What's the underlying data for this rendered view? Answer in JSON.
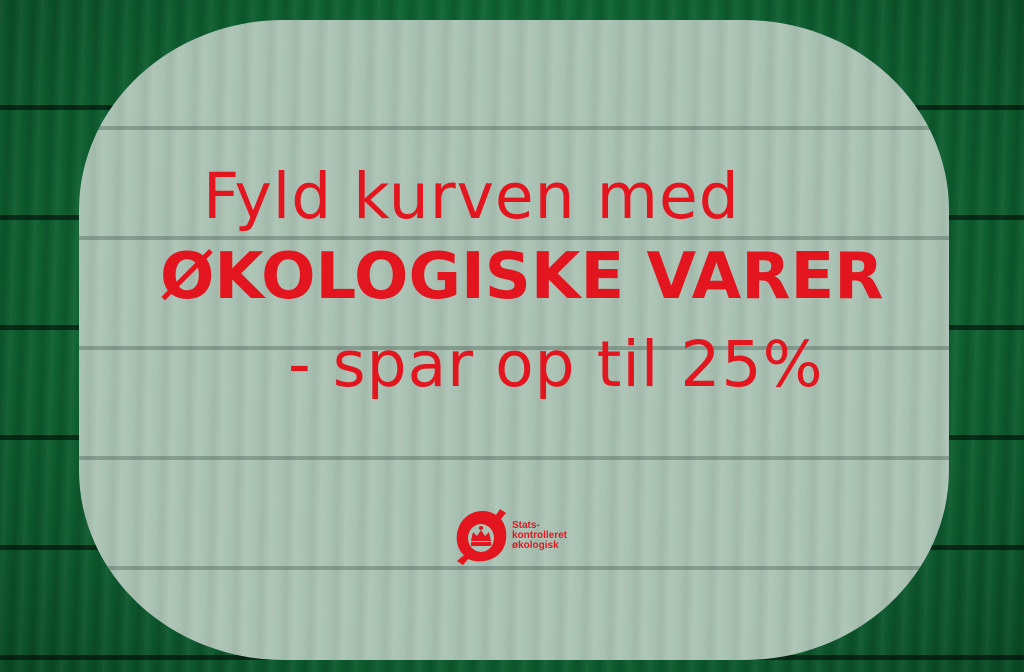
{
  "headline": {
    "line1": "Fyld kurven med",
    "line2": "ØKOLOGISKE VARER",
    "line3": "- spar op til 25%"
  },
  "logo": {
    "icon": "oe-organic-label-icon",
    "lines": [
      "Stats-",
      "kontrolleret",
      "økologisk"
    ]
  },
  "colors": {
    "accent_red": "#e3161f",
    "wood_green": "#0f6433",
    "panel_tint": "#aac2b4"
  }
}
